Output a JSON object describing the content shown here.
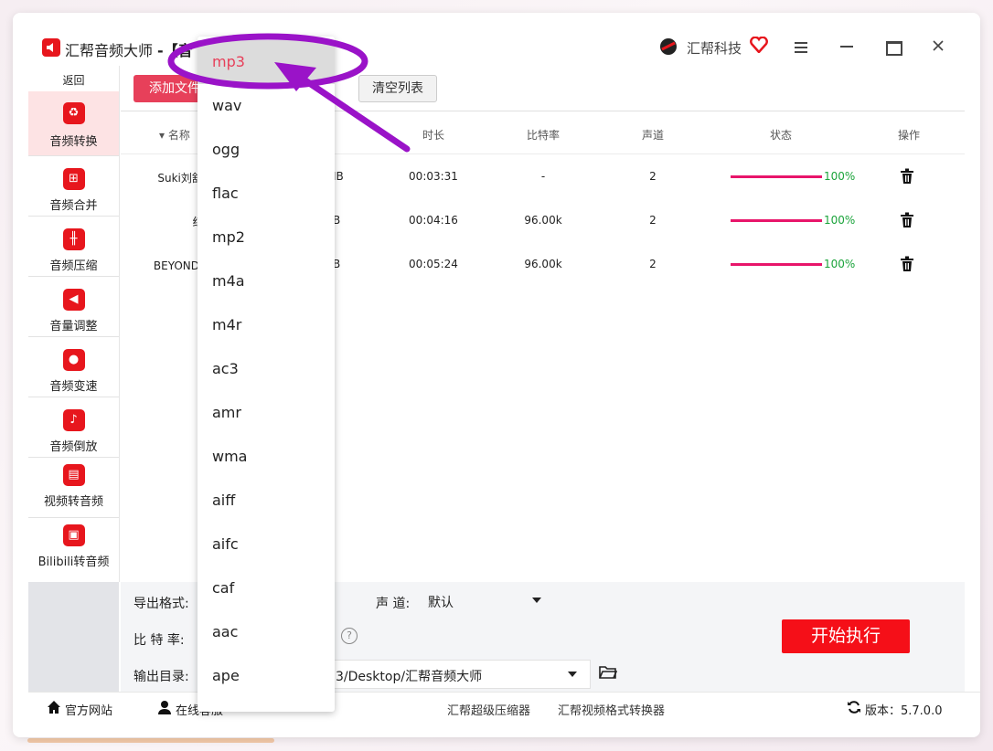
{
  "app": {
    "title": "汇帮音频大师",
    "title_suffix": "-【音",
    "brand": "汇帮科技",
    "menu_icon": "hamburger-icon",
    "minimize_icon": "minimize-icon",
    "maximize_icon": "maximize-icon",
    "close_icon": "close-icon"
  },
  "sidebar": {
    "back_label": "返回",
    "items": [
      {
        "label": "音频转换",
        "icon": "audio-convert-icon",
        "active": true
      },
      {
        "label": "音频合并",
        "icon": "audio-merge-icon"
      },
      {
        "label": "音频压缩",
        "icon": "audio-compress-icon"
      },
      {
        "label": "音量调整",
        "icon": "volume-adjust-icon"
      },
      {
        "label": "音频变速",
        "icon": "audio-speed-icon"
      },
      {
        "label": "音频倒放",
        "icon": "audio-reverse-icon"
      },
      {
        "label": "视频转音频",
        "icon": "video-to-audio-icon"
      },
      {
        "label": "Bilibili转音频",
        "icon": "bilibili-icon"
      }
    ]
  },
  "toolbar": {
    "add_file_label": "添加文件",
    "clear_list_label": "清空列表"
  },
  "table": {
    "columns": [
      "名称",
      "时长",
      "比特率",
      "声道",
      "状态",
      "操作"
    ],
    "rows": [
      {
        "name": "Suki刘舒妤 -",
        "size": "IB",
        "duration": "00:03:31",
        "bitrate": "-",
        "channels": "2",
        "progress": 1.0,
        "progress_label": "100%"
      },
      {
        "name": "红豆.I",
        "size": "B",
        "duration": "00:04:16",
        "bitrate": "96.00k",
        "channels": "2",
        "progress": 1.0,
        "progress_label": "100%"
      },
      {
        "name": "BEYOND - 海",
        "size": "B",
        "duration": "00:05:24",
        "bitrate": "96.00k",
        "channels": "2",
        "progress": 1.0,
        "progress_label": "100%"
      }
    ]
  },
  "settings": {
    "format_label": "导出格式:",
    "channel_label": "声 道:",
    "channel_value": "默认",
    "bitrate_label": "比 特 率:",
    "output_label": "输出目录:",
    "output_value": "3/Desktop/汇帮音频大师",
    "start_button": "开始执行"
  },
  "dropdown": {
    "options": [
      "mp3",
      "wav",
      "ogg",
      "flac",
      "mp2",
      "m4a",
      "m4r",
      "ac3",
      "amr",
      "wma",
      "aiff",
      "aifc",
      "caf",
      "aac",
      "ape"
    ],
    "selected": "mp3"
  },
  "footer": {
    "website": "官方网站",
    "online_service": "在线客服",
    "link1": "汇帮超级压缩器",
    "link2": "汇帮视频格式转换器",
    "version": "版本：5.7.0.0"
  },
  "colors": {
    "accent": "#e7405a",
    "brand_red": "#e7161d",
    "progress": "#e8156a",
    "annotation": "#9a13c8"
  }
}
